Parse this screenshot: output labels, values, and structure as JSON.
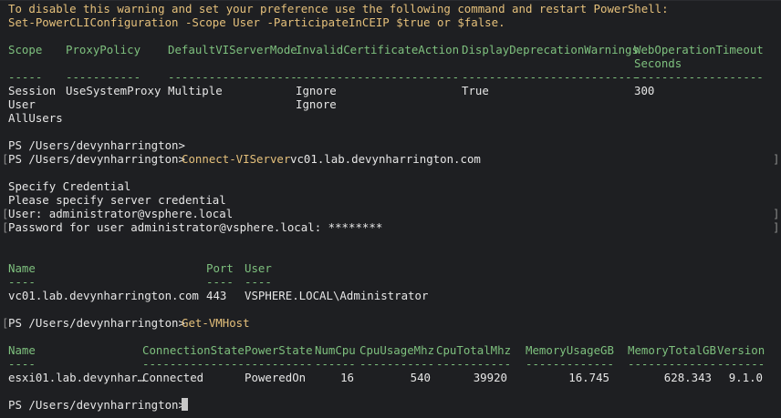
{
  "warning": {
    "line1": "To disable this warning and set your preference use the following command and restart PowerShell:",
    "line2": "Set-PowerCLIConfiguration -Scope User -ParticipateInCEIP $true or $false."
  },
  "config_table": {
    "headers": {
      "scope": "Scope",
      "proxy": "ProxyPolicy",
      "mode": "DefaultVIServerMode",
      "cert": "InvalidCertificateAction",
      "dep": "DisplayDeprecationWarnings",
      "webop1": "WebOperationTimeout",
      "webop2": "Seconds"
    },
    "dashes": {
      "scope": "-----",
      "proxy": "-----------",
      "mode": "-------------------",
      "cert": "------------------------",
      "dep": "--------------------------",
      "webop": "-------------------"
    },
    "rows": [
      {
        "scope": "Session",
        "proxy": "UseSystemProxy",
        "mode": "Multiple",
        "cert": "Ignore",
        "dep": "True",
        "webop": "300"
      },
      {
        "scope": "User",
        "proxy": "",
        "mode": "",
        "cert": "Ignore",
        "dep": "",
        "webop": ""
      },
      {
        "scope": "AllUsers",
        "proxy": "",
        "mode": "",
        "cert": "",
        "dep": "",
        "webop": ""
      }
    ]
  },
  "prompt": "PS /Users/devynharrington>",
  "connect": {
    "command": "Connect-VIServer",
    "args": "vc01.lab.devynharrington.com"
  },
  "credential": {
    "title": "Specify Credential",
    "subtitle": "Please specify server credential",
    "user_line": "User: administrator@vsphere.local",
    "password_line": "Password for user administrator@vsphere.local: ********"
  },
  "server_table": {
    "headers": {
      "name": "Name",
      "port": "Port",
      "user": "User"
    },
    "dashes": {
      "name": "----",
      "port": "----",
      "user": "----"
    },
    "row": {
      "name": "vc01.lab.devynharrington.com",
      "port": "443",
      "user": "VSPHERE.LOCAL\\Administrator"
    }
  },
  "gethost": {
    "command": "Get-VMHost"
  },
  "host_table": {
    "headers": {
      "name": "Name",
      "conn": "ConnectionState",
      "power": "PowerState",
      "numcpu": "NumCpu",
      "cpuusage": "CpuUsageMhz",
      "cputotal": "CpuTotalMhz",
      "memusage": "MemoryUsageGB",
      "memtotal": "MemoryTotalGB",
      "version": "Version"
    },
    "dashes": {
      "name": "----",
      "conn": "---------------",
      "power": "----------",
      "numcpu": "------",
      "cpuusage": "-----------",
      "cputotal": "-----------",
      "memusage": "-------------",
      "memtotal": "-------------",
      "version": "-------"
    },
    "row": {
      "name": "esxi01.lab.devynhar…",
      "conn": "Connected",
      "power": "PoweredOn",
      "numcpu": "16",
      "cpuusage": "540",
      "cputotal": "39920",
      "memusage": "16.745",
      "memtotal": "628.343",
      "version": "9.1.0"
    }
  },
  "brackets": {
    "open": "[",
    "close": "]"
  }
}
